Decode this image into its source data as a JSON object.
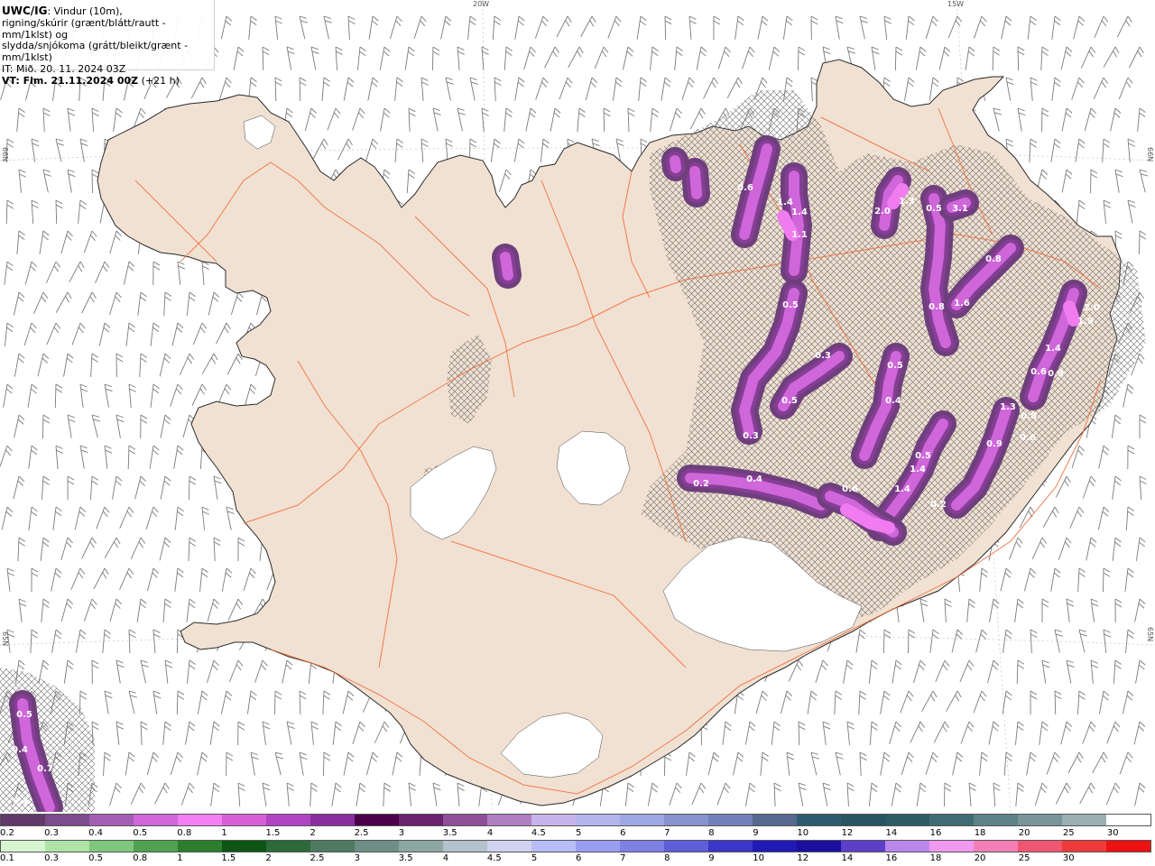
{
  "header": {
    "title_bold": "UWC/IG",
    "title_rest": ": Vindur (10m),",
    "line2": "rigning/skúrir (grænt/blátt/rautt - mm/1klst) og",
    "line3": "slydda/snjókoma (grátt/bleikt/grænt - mm/1klst)",
    "line4": "IT: Mið. 20. 11. 2024 03Z",
    "line5_bold": "VT: Fim. 21.11.2024 00Z",
    "line5_rest": " (+21 h)"
  },
  "geo_labels": {
    "lon_20w": "20W",
    "lon_15w": "15W",
    "lat_66_left": "66N",
    "lat_66_right": "66N",
    "lat_65_left": "65N",
    "lat_65_right": "65N"
  },
  "colors": {
    "land": "#f1e1d3",
    "land_edge": "#2a2a2a",
    "sea": "#ffffff",
    "roads": "#ef6b36",
    "glacier": "#ffffff",
    "barb": "#7a7a7a",
    "precip_light": "#cf66d9",
    "precip_mid": "#f07cf0",
    "precip_dark": "#6e3f7c"
  },
  "precip_labels": [
    "0.6",
    "1.4",
    "1.4",
    "1.1",
    "2.0",
    "1.3",
    "0.5",
    "3.1",
    "0.8",
    "0.8",
    "1.6",
    "0.5",
    "2.0",
    "1.9",
    "1.4",
    "0.6",
    "0.8",
    "0.3",
    "0.5",
    "0.5",
    "0.4",
    "0.3",
    "1.3",
    "0.8",
    "0.6",
    "0.9",
    "0.5",
    "1.4",
    "1.4",
    "0.2",
    "0.4",
    "0.6",
    "0.2",
    "0.5",
    "0.4",
    "0.7",
    "0.4"
  ],
  "legend": {
    "snow_labels": [
      "0.2",
      "0.3",
      "0.4",
      "0.5",
      "0.8",
      "1",
      "1.5",
      "2",
      "2.5",
      "3",
      "3.5",
      "4",
      "4.5",
      "5",
      "6",
      "7",
      "8",
      "9",
      "10",
      "12",
      "14",
      "16",
      "18",
      "20",
      "25",
      "30"
    ],
    "snow_colors": [
      "#5f3a6a",
      "#7e4c8c",
      "#a35db4",
      "#cf66d9",
      "#f37ff3",
      "#d760da",
      "#b144c3",
      "#8a2da0",
      "#4a0048",
      "#6a2270",
      "#8f4f9a",
      "#b07fc0",
      "#c8b4ea",
      "#b4b4ec",
      "#9ea8e2",
      "#8793cc",
      "#7080b8",
      "#55688f",
      "#2f5b6e",
      "#275561",
      "#2d5c67",
      "#3f6c74",
      "#5d8389",
      "#79959a",
      "#9ab0b3",
      "#ffffff"
    ],
    "rain_labels": [
      "0.1",
      "0.3",
      "0.5",
      "0.8",
      "1",
      "1.5",
      "2",
      "2.5",
      "3",
      "3.5",
      "4",
      "4.5",
      "5",
      "6",
      "7",
      "8",
      "9",
      "10",
      "12",
      "14",
      "16",
      "18",
      "20",
      "25",
      "30"
    ],
    "rain_colors": [
      "#d8f5d2",
      "#aee3a6",
      "#7ec77c",
      "#4fa24f",
      "#2c7e2f",
      "#0c5513",
      "#2d6a3a",
      "#4d7a60",
      "#6e8f85",
      "#8da7a2",
      "#b3c2cc",
      "#cfd2f1",
      "#b9bdf7",
      "#9a9ef0",
      "#7e80e4",
      "#5e5ed8",
      "#3a36c8",
      "#1f1ab6",
      "#1b0fa0",
      "#5b3fc8",
      "#b987ea",
      "#ef99ef",
      "#f27fb5",
      "#f05671",
      "#ef3a3a",
      "#ee1111"
    ]
  }
}
